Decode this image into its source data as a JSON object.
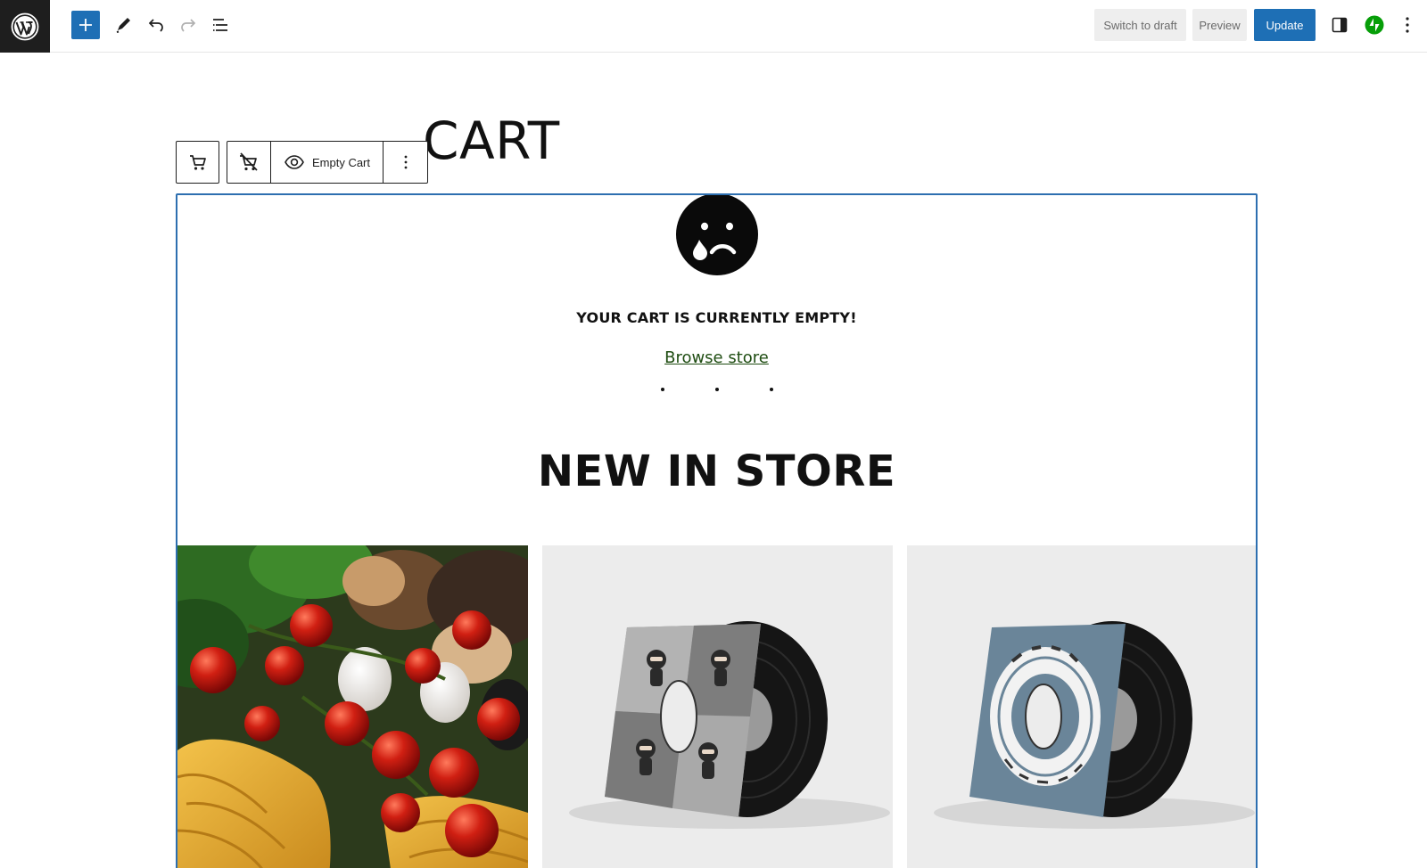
{
  "toolbar": {
    "add_block_label": "Add block",
    "switch_to_draft": "Switch to draft",
    "preview": "Preview",
    "update": "Update"
  },
  "page": {
    "title": "CART"
  },
  "block_toolbar": {
    "view_label": "Empty Cart"
  },
  "cart": {
    "empty_message": "YOUR CART IS CURRENTLY EMPTY!",
    "browse_link": "Browse store",
    "section_heading": "NEW IN STORE"
  },
  "products": [
    {
      "image": "tomatoes-pasta-photo"
    },
    {
      "image": "ninja-vinyl-album"
    },
    {
      "image": "woothemes-vinyl-album"
    }
  ],
  "colors": {
    "accent": "#1e6fb5",
    "block_outline": "#2d6fb0",
    "jetpack": "#069e08",
    "link": "#1f4d12"
  }
}
